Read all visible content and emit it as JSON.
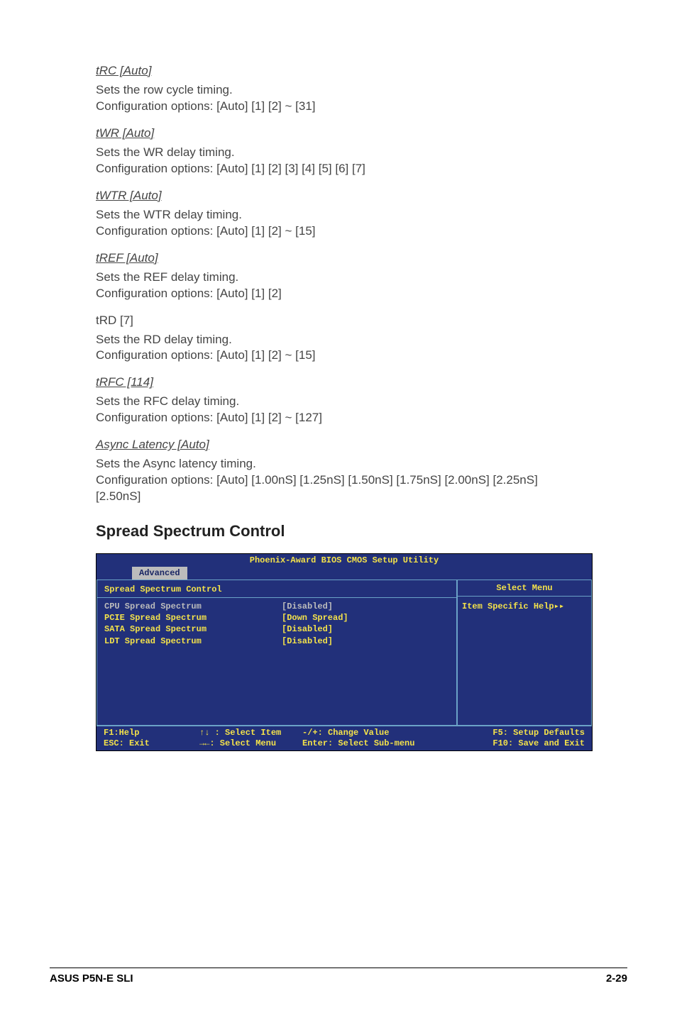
{
  "items": [
    {
      "title": "tRC [Auto]",
      "underline": true,
      "desc": "Sets the row cycle timing.\nConfiguration options: [Auto] [1] [2] ~ [31]"
    },
    {
      "title": "tWR [Auto]",
      "underline": true,
      "desc": "Sets the WR delay timing.\nConfiguration options: [Auto] [1] [2] [3] [4] [5] [6] [7]"
    },
    {
      "title": "tWTR [Auto]",
      "underline": true,
      "desc": "Sets the WTR delay timing.\nConfiguration options: [Auto] [1] [2] ~ [15]"
    },
    {
      "title": "tREF [Auto]",
      "underline": true,
      "desc": "Sets the REF delay timing.\nConfiguration options: [Auto] [1] [2]"
    },
    {
      "title": "tRD [7]",
      "underline": false,
      "desc": "Sets the RD delay timing.\nConfiguration options: [Auto] [1] [2] ~ [15]"
    },
    {
      "title": "tRFC [114]",
      "underline": true,
      "desc": "Sets the RFC delay timing.\nConfiguration options: [Auto] [1] [2] ~ [127]"
    },
    {
      "title": "Async Latency [Auto]",
      "underline": true,
      "desc": "Sets the Async latency timing.\nConfiguration options: [Auto] [1.00nS] [1.25nS] [1.50nS] [1.75nS] [2.00nS] [2.25nS] [2.50nS]"
    }
  ],
  "section_heading": "Spread Spectrum Control",
  "bios": {
    "title": "Phoenix-Award BIOS CMOS Setup Utility",
    "tab": "Advanced",
    "subheader": "Spread Spectrum Control",
    "selectmenu": "Select Menu",
    "helptext": "Item Specific Help▸▸",
    "rows": [
      {
        "label": "CPU Spread Spectrum",
        "value": "[Disabled]",
        "gray": true
      },
      {
        "label": "PCIE Spread Spectrum",
        "value": "[Down Spread]",
        "gray": false
      },
      {
        "label": "SATA Spread Spectrum",
        "value": "[Disabled]",
        "gray": false
      },
      {
        "label": "LDT Spread Spectrum",
        "value": "[Disabled]",
        "gray": false
      }
    ],
    "footer": {
      "c1a": "F1:Help",
      "c1b": "ESC: Exit",
      "c2a": "↑↓ : Select Item",
      "c2b": "→←: Select Menu",
      "c3a": "-/+: Change Value",
      "c3b": "Enter: Select Sub-menu",
      "c4a": "F5: Setup Defaults",
      "c4b": "F10: Save and Exit"
    }
  },
  "footer": {
    "left": "ASUS P5N-E SLI",
    "right": "2-29"
  }
}
